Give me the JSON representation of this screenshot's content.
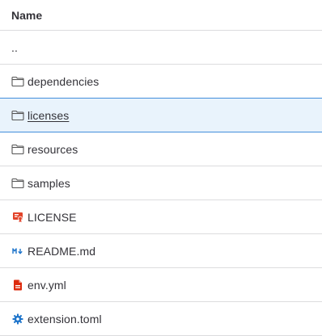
{
  "table": {
    "header": {
      "name_label": "Name"
    },
    "rows": [
      {
        "label": "..",
        "type": "parent"
      },
      {
        "label": "dependencies",
        "type": "folder",
        "icon": "folder-icon"
      },
      {
        "label": "licenses",
        "type": "folder",
        "icon": "folder-icon",
        "selected": true
      },
      {
        "label": "resources",
        "type": "folder",
        "icon": "folder-icon"
      },
      {
        "label": "samples",
        "type": "folder",
        "icon": "folder-icon"
      },
      {
        "label": "LICENSE",
        "type": "file",
        "icon": "license-file-icon"
      },
      {
        "label": "README.md",
        "type": "file",
        "icon": "markdown-file-icon"
      },
      {
        "label": "env.yml",
        "type": "file",
        "icon": "yaml-file-icon"
      },
      {
        "label": "extension.toml",
        "type": "file",
        "icon": "gear-file-icon"
      }
    ]
  },
  "colors": {
    "selected_bg": "#e9f3fc",
    "selected_border": "#428fdc",
    "row_border": "#dcdcde",
    "license_icon": "#e24329",
    "markdown_icon": "#1f75cb",
    "yaml_icon": "#dd2b0e",
    "gear_icon": "#1f75cb"
  }
}
